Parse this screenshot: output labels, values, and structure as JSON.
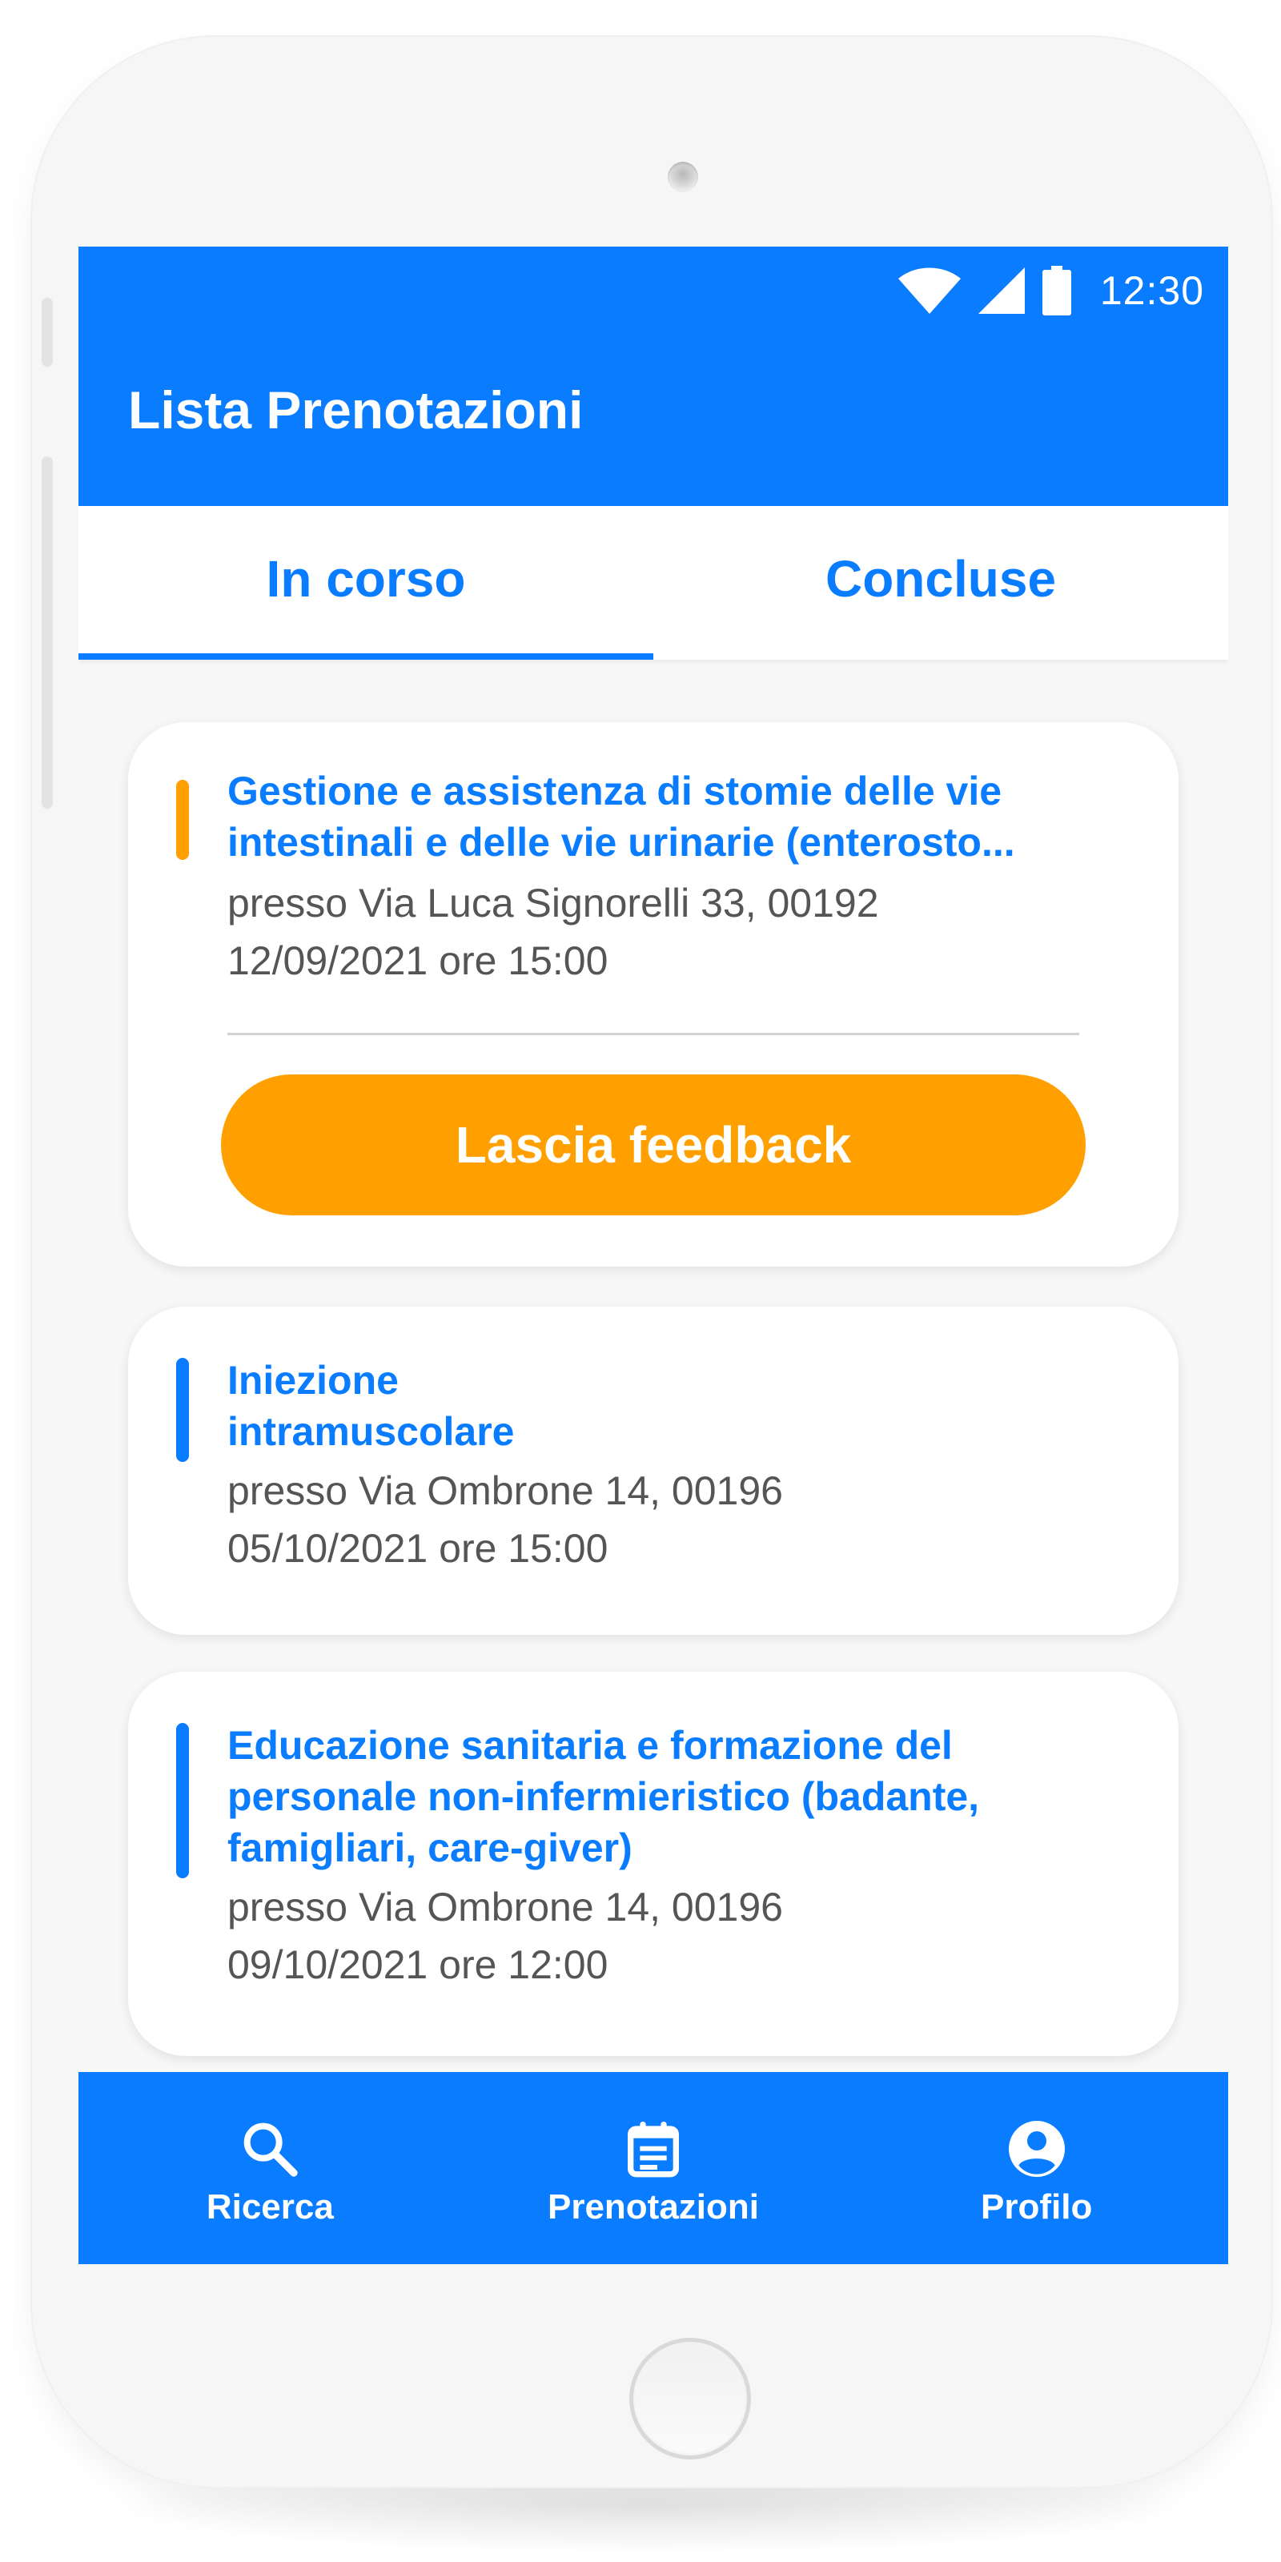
{
  "status_bar": {
    "time": "12:30",
    "icons": [
      "wifi-icon",
      "cellular-signal-icon",
      "battery-icon"
    ]
  },
  "app": {
    "title": "Lista Prenotazioni"
  },
  "tabs": [
    {
      "label": "In corso",
      "active": true
    },
    {
      "label": "Concluse",
      "active": false
    }
  ],
  "bookings": [
    {
      "title_line1": "Gestione e assistenza di stomie delle vie",
      "title_line2": "intestinali e delle vie urinarie (enterosto...",
      "address": "presso Via Luca Signorelli 33, 00192",
      "datetime": "12/09/2021 ore 15:00",
      "accent_color": "#ff9f00",
      "action_label": "Lascia feedback"
    },
    {
      "title_line1": "Iniezione",
      "title_line2": "intramuscolare",
      "address": "presso Via Ombrone 14, 00196",
      "datetime": "05/10/2021 ore 15:00",
      "accent_color": "#0a7cff"
    },
    {
      "title_line1": "Educazione sanitaria e formazione del",
      "title_line2": "personale non-infermieristico (badante,",
      "title_line3": "famigliari, care-giver)",
      "address": "presso Via Ombrone 14, 00196",
      "datetime": "09/10/2021 ore 12:00",
      "accent_color": "#0a7cff"
    }
  ],
  "bottom_nav": [
    {
      "label": "Ricerca",
      "icon": "search-icon"
    },
    {
      "label": "Prenotazioni",
      "icon": "calendar-icon"
    },
    {
      "label": "Profilo",
      "icon": "account-circle-icon"
    }
  ],
  "colors": {
    "primary": "#0a7cff",
    "accent": "#ff9f00",
    "text_secondary": "#555555",
    "screen_bg": "#f7f7f7",
    "device_body": "#f6f6f6"
  }
}
